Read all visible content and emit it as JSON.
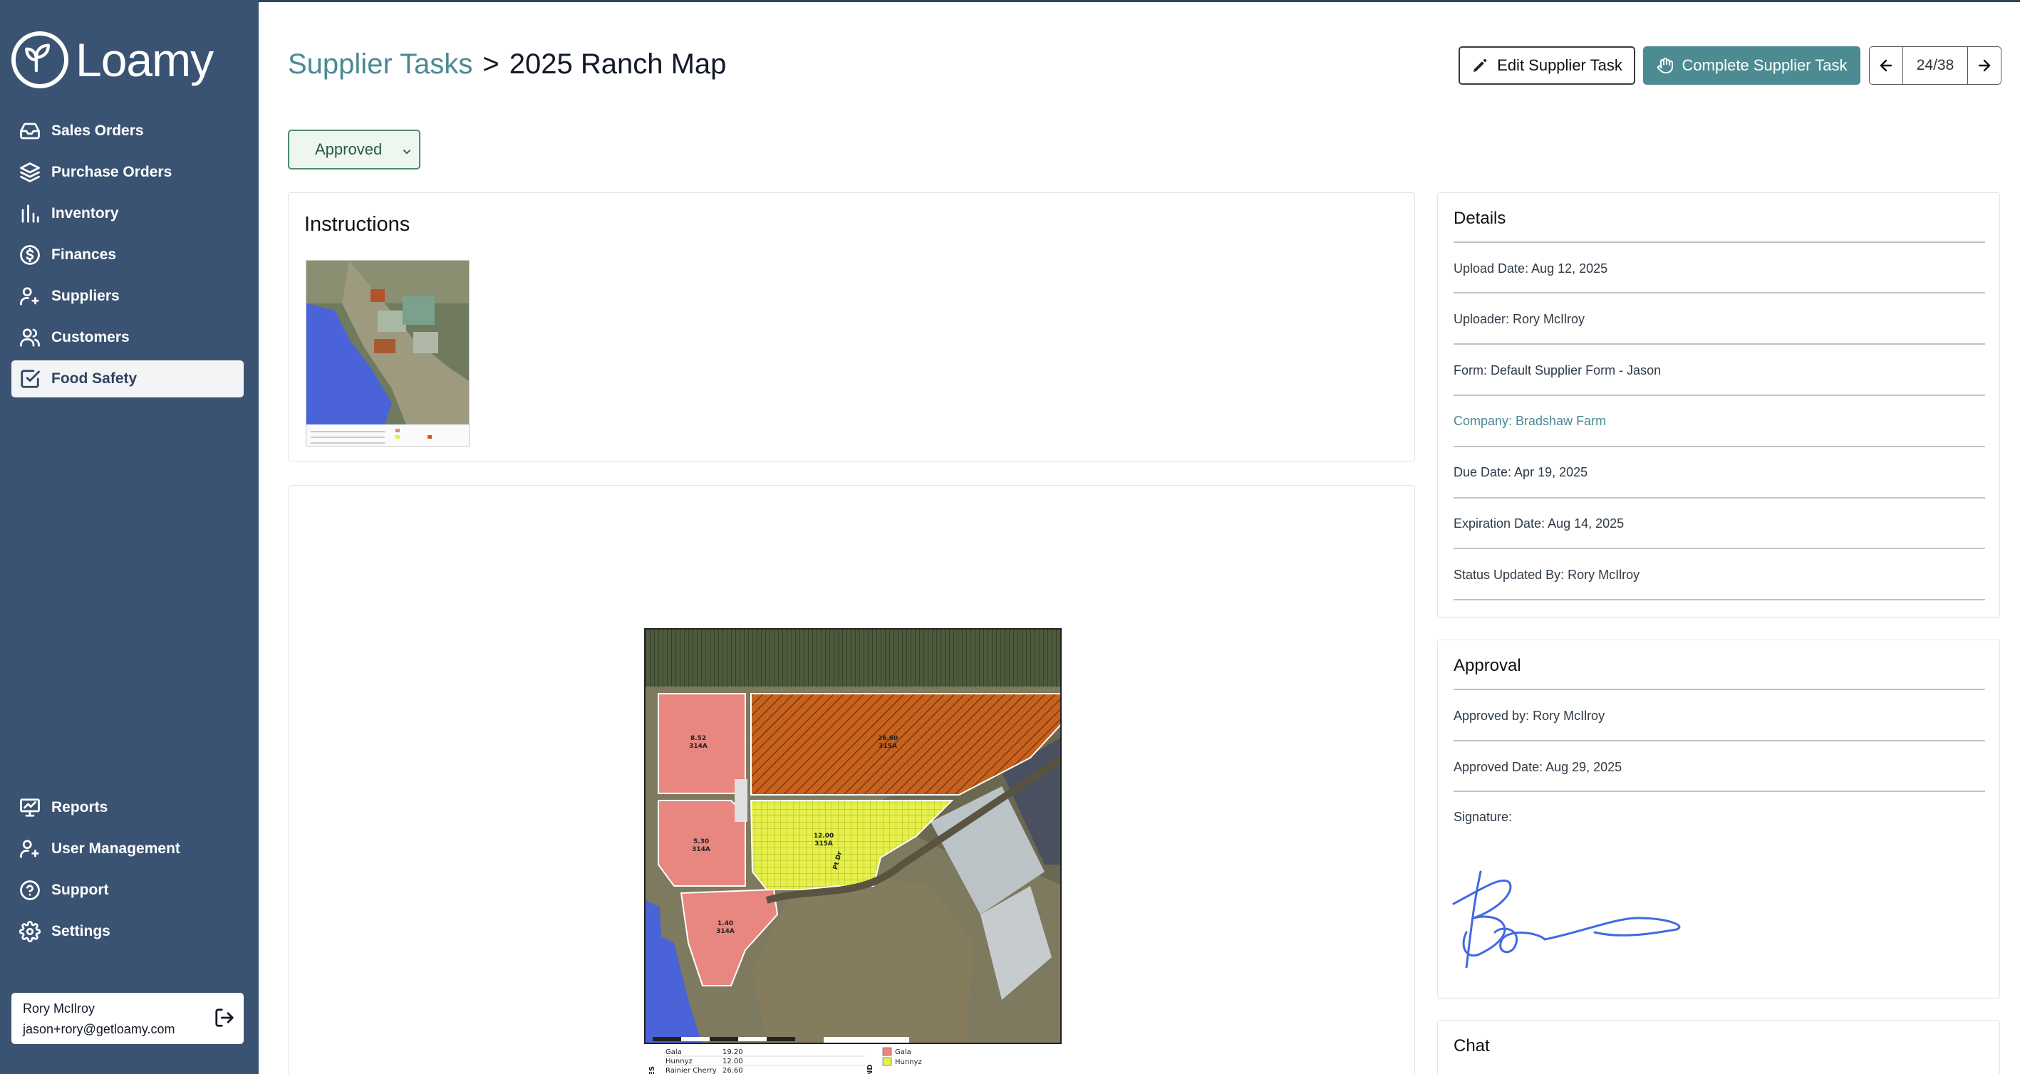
{
  "app": {
    "brand": "Loamy"
  },
  "sidebar": {
    "items": [
      {
        "label": "Sales Orders",
        "icon": "inbox-icon"
      },
      {
        "label": "Purchase Orders",
        "icon": "layers-icon"
      },
      {
        "label": "Inventory",
        "icon": "bar-chart-icon"
      },
      {
        "label": "Finances",
        "icon": "dollar-circle-icon"
      },
      {
        "label": "Suppliers",
        "icon": "user-plus-icon"
      },
      {
        "label": "Customers",
        "icon": "users-icon"
      },
      {
        "label": "Food Safety",
        "icon": "check-square-icon",
        "active": true
      }
    ],
    "bottom_items": [
      {
        "label": "Reports",
        "icon": "presentation-icon"
      },
      {
        "label": "User Management",
        "icon": "user-add-icon"
      },
      {
        "label": "Support",
        "icon": "help-circle-icon"
      },
      {
        "label": "Settings",
        "icon": "gear-icon"
      }
    ],
    "user": {
      "name": "Rory McIlroy",
      "email": "jason+rory@getloamy.com"
    }
  },
  "header": {
    "breadcrumb_parent": "Supplier Tasks",
    "separator": ">",
    "title": "2025 Ranch Map",
    "edit_label": "Edit Supplier Task",
    "complete_label": "Complete Supplier Task",
    "pager": "24/38"
  },
  "status": {
    "selected": "Approved"
  },
  "instructions": {
    "title": "Instructions"
  },
  "details": {
    "title": "Details",
    "rows": [
      "Upload Date: Aug 12, 2025",
      "Uploader: Rory McIlroy",
      "Form: Default Supplier Form - Jason",
      "Company: Bradshaw Farm",
      "Due Date: Apr 19, 2025",
      "Expiration Date: Aug 14, 2025",
      "Status Updated By: Rory McIlroy"
    ]
  },
  "approval": {
    "title": "Approval",
    "approved_by": "Approved by: Rory McIlroy",
    "approved_date": "Approved Date: Aug 29, 2025",
    "signature_label": "Signature:"
  },
  "chat": {
    "title": "Chat"
  },
  "map": {
    "labels": [
      "8.52",
      "314A",
      "26.60",
      "315A",
      "5.30",
      "314A",
      "12.00",
      "315A",
      "1.40",
      "314A",
      "Pt Dr"
    ],
    "legend_left_heading": "CRES",
    "legend_right_heading": "GEND",
    "legend_rows": [
      {
        "name": "Gala",
        "acres": "19.20",
        "color": "#e8877f"
      },
      {
        "name": "Hunnyz",
        "acres": "12.00",
        "color": "#e6f04a"
      },
      {
        "name": "Rainier Cherry",
        "acres": "26.60",
        "color": "#c8611e"
      }
    ]
  },
  "colors": {
    "sidebar": "#3a5373",
    "accent": "#4d8b92",
    "approved_bg": "#eef6f0"
  }
}
